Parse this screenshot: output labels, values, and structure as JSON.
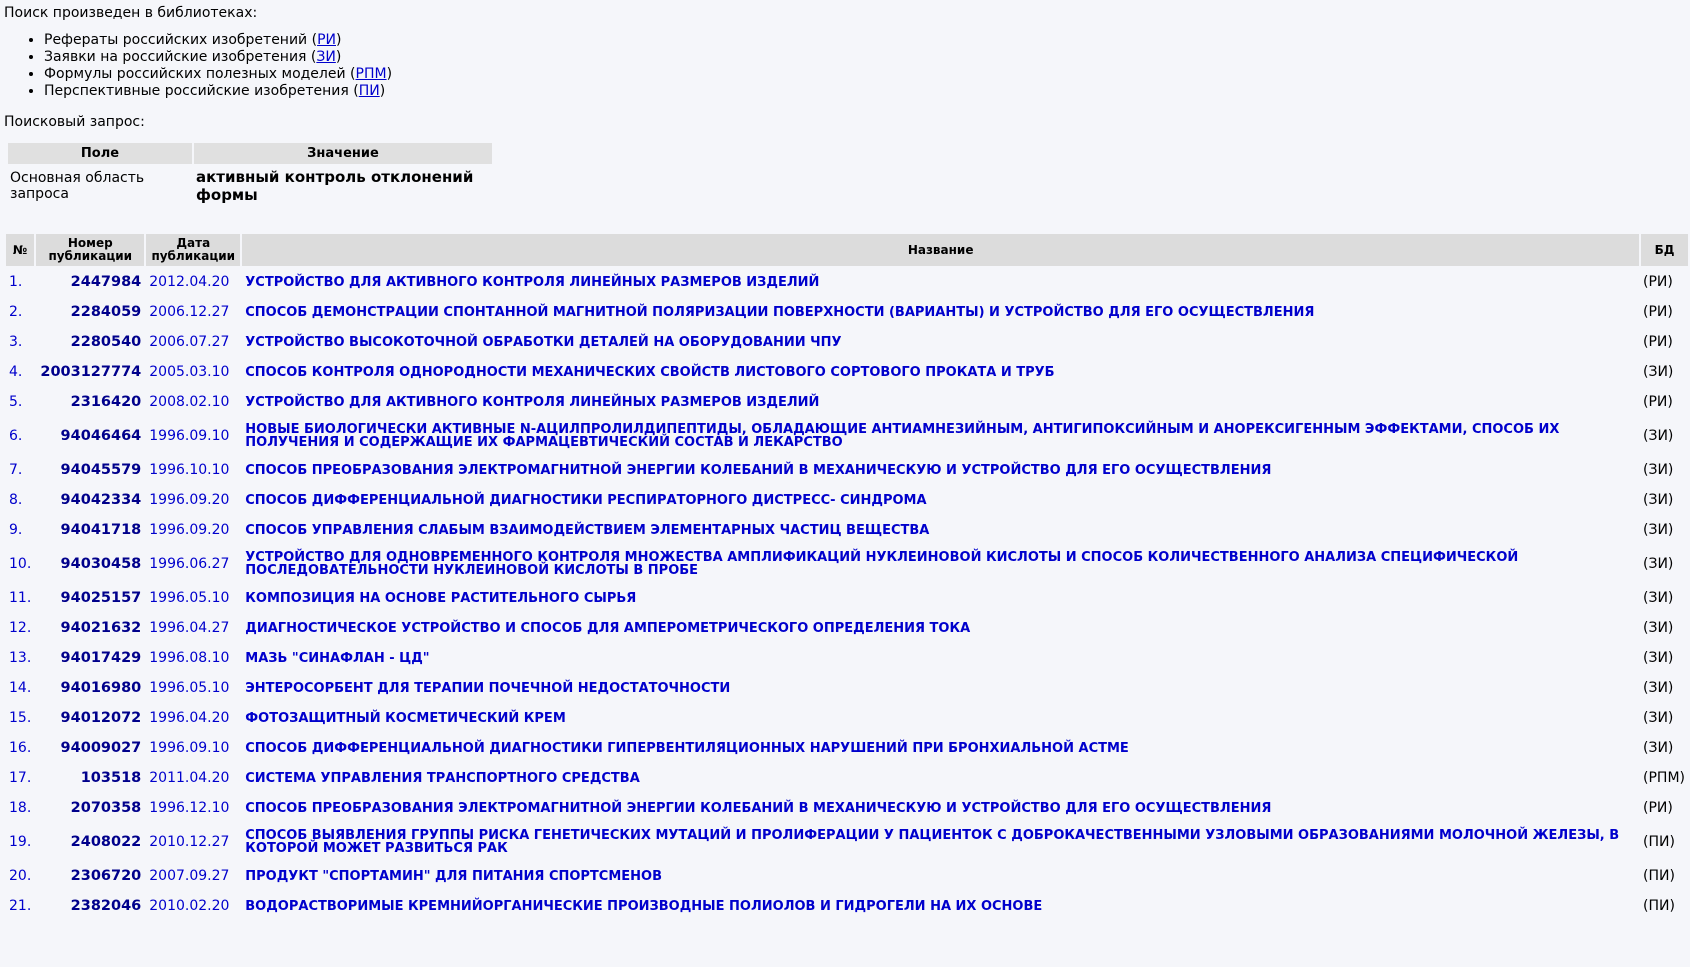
{
  "intro": "Поиск произведен в библиотеках:",
  "libraries": [
    {
      "name": "Рефераты российских изобретений",
      "code": "РИ"
    },
    {
      "name": "Заявки на российские изобретения",
      "code": "ЗИ"
    },
    {
      "name": "Формулы российских полезных моделей",
      "code": "РПМ"
    },
    {
      "name": "Перспективные российские изобретения",
      "code": "ПИ"
    }
  ],
  "query_label": "Поисковый запрос:",
  "query_table": {
    "headers": [
      "Поле",
      "Значение"
    ],
    "field": "Основная область запроса",
    "value": "активный контроль отклонений формы"
  },
  "results": {
    "headers": {
      "n": "№",
      "number": "Номер публикации",
      "date": "Дата публикации",
      "title": "Название",
      "db": "БД"
    },
    "rows": [
      {
        "n": "1.",
        "number": "2447984",
        "date": "2012.04.20",
        "title": "УСТРОЙСТВО ДЛЯ АКТИВНОГО КОНТРОЛЯ ЛИНЕЙНЫХ РАЗМЕРОВ ИЗДЕЛИЙ",
        "db": "(РИ)"
      },
      {
        "n": "2.",
        "number": "2284059",
        "date": "2006.12.27",
        "title": "СПОСОБ ДЕМОНСТРАЦИИ СПОНТАННОЙ МАГНИТНОЙ ПОЛЯРИЗАЦИИ ПОВЕРХНОСТИ (ВАРИАНТЫ) И УСТРОЙСТВО ДЛЯ ЕГО ОСУЩЕСТВЛЕНИЯ",
        "db": "(РИ)"
      },
      {
        "n": "3.",
        "number": "2280540",
        "date": "2006.07.27",
        "title": "УСТРОЙСТВО ВЫСОКОТОЧНОЙ ОБРАБОТКИ ДЕТАЛЕЙ НА ОБОРУДОВАНИИ ЧПУ",
        "db": "(РИ)"
      },
      {
        "n": "4.",
        "number": "2003127774",
        "date": "2005.03.10",
        "title": "СПОСОБ КОНТРОЛЯ ОДНОРОДНОСТИ МЕХАНИЧЕСКИХ СВОЙСТВ ЛИСТОВОГО СОРТОВОГО ПРОКАТА И ТРУБ",
        "db": "(ЗИ)"
      },
      {
        "n": "5.",
        "number": "2316420",
        "date": "2008.02.10",
        "title": "УСТРОЙСТВО ДЛЯ АКТИВНОГО КОНТРОЛЯ ЛИНЕЙНЫХ РАЗМЕРОВ ИЗДЕЛИЙ",
        "db": "(РИ)"
      },
      {
        "n": "6.",
        "number": "94046464",
        "date": "1996.09.10",
        "title": "НОВЫЕ БИОЛОГИЧЕСКИ АКТИВНЫЕ N-АЦИЛПРОЛИЛДИПЕПТИДЫ, ОБЛАДАЮЩИЕ АНТИАМНЕЗИЙНЫМ, АНТИГИПОКСИЙНЫМ И АНОРЕКСИГЕННЫМ ЭФФЕКТАМИ, СПОСОБ ИХ ПОЛУЧЕНИЯ И СОДЕРЖАЩИЕ ИХ ФАРМАЦЕВТИЧЕСКИЙ СОСТАВ И ЛЕКАРСТВО",
        "db": "(ЗИ)",
        "tall": true
      },
      {
        "n": "7.",
        "number": "94045579",
        "date": "1996.10.10",
        "title": "СПОСОБ ПРЕОБРАЗОВАНИЯ ЭЛЕКТРОМАГНИТНОЙ ЭНЕРГИИ КОЛЕБАНИЙ В МЕХАНИЧЕСКУЮ И УСТРОЙСТВО ДЛЯ ЕГО ОСУЩЕСТВЛЕНИЯ",
        "db": "(ЗИ)"
      },
      {
        "n": "8.",
        "number": "94042334",
        "date": "1996.09.20",
        "title": "СПОСОБ ДИФФЕРЕНЦИАЛЬНОЙ ДИАГНОСТИКИ РЕСПИРАТОРНОГО ДИСТРЕСС- СИНДРОМА",
        "db": "(ЗИ)"
      },
      {
        "n": "9.",
        "number": "94041718",
        "date": "1996.09.20",
        "title": "СПОСОБ УПРАВЛЕНИЯ СЛАБЫМ ВЗАИМОДЕЙСТВИЕМ ЭЛЕМЕНТАРНЫХ ЧАСТИЦ ВЕЩЕСТВА",
        "db": "(ЗИ)"
      },
      {
        "n": "10.",
        "number": "94030458",
        "date": "1996.06.27",
        "title": "УСТРОЙСТВО ДЛЯ ОДНОВРЕМЕННОГО КОНТРОЛЯ МНОЖЕСТВА АМПЛИФИКАЦИЙ НУКЛЕИНОВОЙ КИСЛОТЫ И СПОСОБ КОЛИЧЕСТВЕННОГО АНАЛИЗА СПЕЦИФИЧЕСКОЙ ПОСЛЕДОВАТЕЛЬНОСТИ НУКЛЕИНОВОЙ КИСЛОТЫ В ПРОБЕ",
        "db": "(ЗИ)",
        "tall": true
      },
      {
        "n": "11.",
        "number": "94025157",
        "date": "1996.05.10",
        "title": "КОМПОЗИЦИЯ НА ОСНОВЕ РАСТИТЕЛЬНОГО СЫРЬЯ",
        "db": "(ЗИ)"
      },
      {
        "n": "12.",
        "number": "94021632",
        "date": "1996.04.27",
        "title": "ДИАГНОСТИЧЕСКОЕ УСТРОЙСТВО И СПОСОБ ДЛЯ АМПЕРОМЕТРИЧЕСКОГО ОПРЕДЕЛЕНИЯ ТОКА",
        "db": "(ЗИ)"
      },
      {
        "n": "13.",
        "number": "94017429",
        "date": "1996.08.10",
        "title": "МАЗЬ \"СИНАФЛАН - ЦД\"",
        "db": "(ЗИ)"
      },
      {
        "n": "14.",
        "number": "94016980",
        "date": "1996.05.10",
        "title": "ЭНТЕРОСОРБЕНТ ДЛЯ ТЕРАПИИ ПОЧЕЧНОЙ НЕДОСТАТОЧНОСТИ",
        "db": "(ЗИ)"
      },
      {
        "n": "15.",
        "number": "94012072",
        "date": "1996.04.20",
        "title": "ФОТОЗАЩИТНЫЙ КОСМЕТИЧЕСКИЙ КРЕМ",
        "db": "(ЗИ)"
      },
      {
        "n": "16.",
        "number": "94009027",
        "date": "1996.09.10",
        "title": "СПОСОБ ДИФФЕРЕНЦИАЛЬНОЙ ДИАГНОСТИКИ ГИПЕРВЕНТИЛЯЦИОННЫХ НАРУШЕНИЙ ПРИ БРОНХИАЛЬНОЙ АСТМЕ",
        "db": "(ЗИ)"
      },
      {
        "n": "17.",
        "number": "103518",
        "date": "2011.04.20",
        "title": "СИСТЕМА УПРАВЛЕНИЯ ТРАНСПОРТНОГО СРЕДСТВА",
        "db": "(РПМ)"
      },
      {
        "n": "18.",
        "number": "2070358",
        "date": "1996.12.10",
        "title": "СПОСОБ ПРЕОБРАЗОВАНИЯ ЭЛЕКТРОМАГНИТНОЙ ЭНЕРГИИ КОЛЕБАНИЙ В МЕХАНИЧЕСКУЮ И УСТРОЙСТВО ДЛЯ ЕГО ОСУЩЕСТВЛЕНИЯ",
        "db": "(РИ)"
      },
      {
        "n": "19.",
        "number": "2408022",
        "date": "2010.12.27",
        "title": "СПОСОБ ВЫЯВЛЕНИЯ ГРУППЫ РИСКА ГЕНЕТИЧЕСКИХ МУТАЦИЙ И ПРОЛИФЕРАЦИИ У ПАЦИЕНТОК С ДОБРОКАЧЕСТВЕННЫМИ УЗЛОВЫМИ ОБРАЗОВАНИЯМИ МОЛОЧНОЙ ЖЕЛЕЗЫ, В КОТОРОЙ МОЖЕТ РАЗВИТЬСЯ РАК",
        "db": "(ПИ)",
        "tall": true
      },
      {
        "n": "20.",
        "number": "2306720",
        "date": "2007.09.27",
        "title": "ПРОДУКТ \"СПОРТАМИН\" ДЛЯ ПИТАНИЯ СПОРТСМЕНОВ",
        "db": "(ПИ)"
      },
      {
        "n": "21.",
        "number": "2382046",
        "date": "2010.02.20",
        "title": "ВОДОРАСТВОРИМЫЕ КРЕМНИЙОРГАНИЧЕСКИЕ ПРОИЗВОДНЫЕ ПОЛИОЛОВ И ГИДРОГЕЛИ НА ИХ ОСНОВЕ",
        "db": "(ПИ)"
      }
    ]
  }
}
